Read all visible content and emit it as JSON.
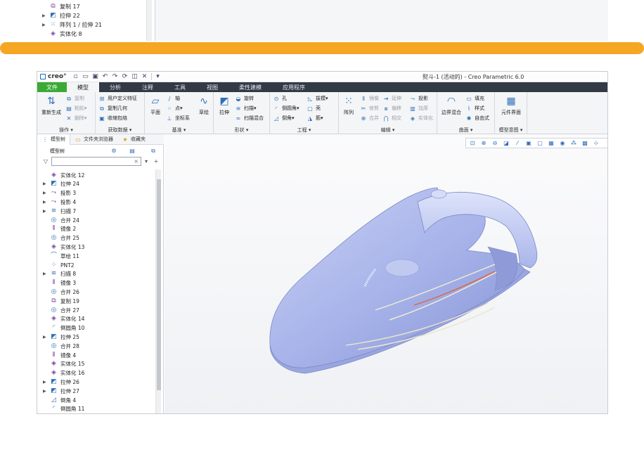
{
  "prev_tree": [
    {
      "label": "复制 17",
      "icon": "copy-icon",
      "expandable": false
    },
    {
      "label": "拉伸 22",
      "icon": "extrude-icon",
      "expandable": true
    },
    {
      "label": "阵列 1 / 拉伸 21",
      "icon": "pattern-icon",
      "expandable": true
    },
    {
      "label": "实体化 8",
      "icon": "solidify-icon",
      "expandable": false
    }
  ],
  "titlebar": {
    "logo": "creo°",
    "title": "熨斗-1 (活动的) - Creo Parametric 6.0"
  },
  "tabs": [
    "文件",
    "模型",
    "分析",
    "注释",
    "工具",
    "视图",
    "柔性建模",
    "应用程序"
  ],
  "ribbon": {
    "operations": {
      "title": "操作",
      "regenerate": "重新生成",
      "copy": "复制",
      "paste": "粘贴",
      "delete": "删除"
    },
    "get_data": {
      "title": "获取数据",
      "udf": "用户定义特征",
      "copy_geom": "复制几何",
      "shrinkwrap": "收缩包络"
    },
    "datum": {
      "title": "基准",
      "plane": "平面",
      "axis": "轴",
      "point": "点",
      "csys": "坐标系",
      "sketch": "草绘"
    },
    "shapes": {
      "title": "形状",
      "extrude": "拉伸",
      "revolve": "旋转",
      "sweep": "扫描",
      "swept_blend": "扫描混合"
    },
    "engineering": {
      "title": "工程",
      "hole": "孔",
      "round": "倒圆角",
      "chamfer": "倒角",
      "draft": "拔模",
      "shell": "壳",
      "rib": "筋"
    },
    "editing": {
      "title": "编辑",
      "pattern": "阵列",
      "mirror": "镜像",
      "extend": "延伸",
      "project": "投影",
      "trim": "修剪",
      "offset": "偏移",
      "thicken": "加厚",
      "merge": "合并",
      "intersect": "相交",
      "solidify": "实体化"
    },
    "surfaces": {
      "title": "曲面",
      "boundary_blend": "边界混合",
      "fill": "填充",
      "style": "样式",
      "freestyle": "自由式"
    },
    "model_intent": {
      "title": "模型意图",
      "component_interface": "元件界面"
    }
  },
  "panel": {
    "tabs": [
      "模型树",
      "文件夹浏览器",
      "收藏夹"
    ],
    "tree_header": "模型树",
    "search_placeholder": "",
    "tree": [
      {
        "label": "实体化 12",
        "icon": "solidify-icon",
        "expandable": false
      },
      {
        "label": "拉伸 24",
        "icon": "extrude-icon",
        "expandable": true
      },
      {
        "label": "投影 3",
        "icon": "project-icon",
        "expandable": true
      },
      {
        "label": "投影 4",
        "icon": "project-icon",
        "expandable": true
      },
      {
        "label": "扫描 7",
        "icon": "sweep-icon",
        "expandable": true
      },
      {
        "label": "合并 24",
        "icon": "merge-icon",
        "expandable": false
      },
      {
        "label": "镜像 2",
        "icon": "mirror-icon",
        "expandable": false
      },
      {
        "label": "合并 25",
        "icon": "merge-icon",
        "expandable": false
      },
      {
        "label": "实体化 13",
        "icon": "solidify-icon",
        "expandable": false
      },
      {
        "label": "草绘 11",
        "icon": "sketch-icon",
        "expandable": false
      },
      {
        "label": "PNT2",
        "icon": "point-icon",
        "expandable": false
      },
      {
        "label": "扫描 8",
        "icon": "sweep-icon",
        "expandable": true
      },
      {
        "label": "镜像 3",
        "icon": "mirror-icon",
        "expandable": false
      },
      {
        "label": "合并 26",
        "icon": "merge-icon",
        "expandable": false
      },
      {
        "label": "复制 19",
        "icon": "copy-icon",
        "expandable": false
      },
      {
        "label": "合并 27",
        "icon": "merge-icon",
        "expandable": false
      },
      {
        "label": "实体化 14",
        "icon": "solidify-icon",
        "expandable": false
      },
      {
        "label": "倒圆角 10",
        "icon": "round-icon",
        "expandable": false
      },
      {
        "label": "拉伸 25",
        "icon": "extrude-icon",
        "expandable": true
      },
      {
        "label": "合并 28",
        "icon": "merge-icon",
        "expandable": false
      },
      {
        "label": "镜像 4",
        "icon": "mirror-icon",
        "expandable": false
      },
      {
        "label": "实体化 15",
        "icon": "solidify-icon",
        "expandable": false
      },
      {
        "label": "实体化 16",
        "icon": "solidify-icon",
        "expandable": false
      },
      {
        "label": "拉伸 26",
        "icon": "extrude-icon",
        "expandable": true
      },
      {
        "label": "拉伸 27",
        "icon": "extrude-icon",
        "expandable": true
      },
      {
        "label": "倒角 4",
        "icon": "chamfer-icon",
        "expandable": false
      },
      {
        "label": "倒圆角 11",
        "icon": "round-icon",
        "expandable": false
      }
    ]
  },
  "colors": {
    "accent_bar": "#f5a623",
    "file_tab": "#3aaa35",
    "tabbar": "#323a45",
    "model_body": "#a8b4ea",
    "icon_blue": "#2f6fb6",
    "feature_purple": "#7b3fa0"
  }
}
